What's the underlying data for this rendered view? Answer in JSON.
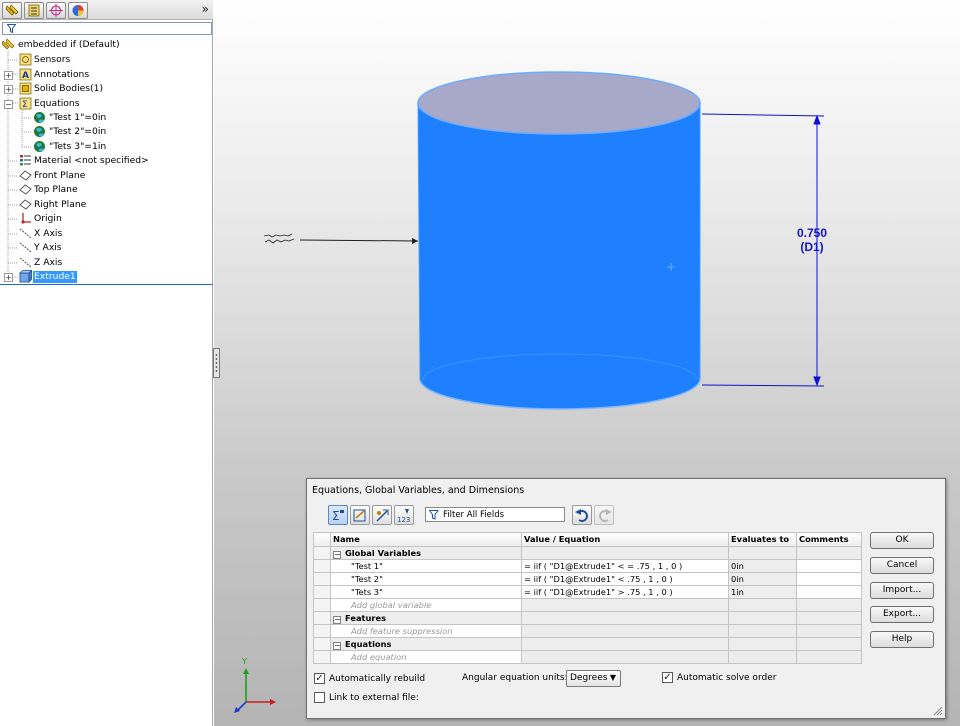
{
  "tree": {
    "root": "embedded if  (Default)",
    "items": [
      {
        "label": "Sensors",
        "icon": "sensors-icon",
        "expandable": false
      },
      {
        "label": "Annotations",
        "icon": "annotations-icon",
        "expandable": true
      },
      {
        "label": "Solid Bodies(1)",
        "icon": "solid-bodies-icon",
        "expandable": true
      },
      {
        "label": "Equations",
        "icon": "equations-icon",
        "expandable": true,
        "expanded": true
      },
      {
        "label": "\"Test 1\"=0in",
        "icon": "globe-icon"
      },
      {
        "label": "\"Test 2\"=0in",
        "icon": "globe-icon"
      },
      {
        "label": "\"Tets 3\"=1in",
        "icon": "globe-icon"
      },
      {
        "label": "Material <not specified>",
        "icon": "material-icon"
      },
      {
        "label": "Front Plane",
        "icon": "plane-icon"
      },
      {
        "label": "Top Plane",
        "icon": "plane-icon"
      },
      {
        "label": "Right Plane",
        "icon": "plane-icon"
      },
      {
        "label": "Origin",
        "icon": "origin-icon"
      },
      {
        "label": "X Axis",
        "icon": "axis-icon"
      },
      {
        "label": "Y Axis",
        "icon": "axis-icon"
      },
      {
        "label": "Z Axis",
        "icon": "axis-icon"
      },
      {
        "label": "Extrude1",
        "icon": "extrude-icon",
        "expandable": true,
        "selected": true
      }
    ]
  },
  "graphics": {
    "dimension_value": "0.750",
    "dimension_name": "(D1)",
    "body_color": "#1e7fff"
  },
  "dialog": {
    "title": "Equations, Global Variables, and Dimensions",
    "filter_placeholder": "Filter All Fields",
    "columns": [
      "Name",
      "Value / Equation",
      "Evaluates to",
      "Comments"
    ],
    "sections": {
      "globals": "Global Variables",
      "features": "Features",
      "equations": "Equations"
    },
    "rows": [
      {
        "name": "\"Test 1\"",
        "equation": "= iif ( \"D1@Extrude1\" < = .75 , 1 , 0 )",
        "evaluates": "0in",
        "comment": ""
      },
      {
        "name": "\"Test 2\"",
        "equation": "= iif ( \"D1@Extrude1\" < .75 , 1 , 0 )",
        "evaluates": "0in",
        "comment": ""
      },
      {
        "name": "\"Tets 3\"",
        "equation": "= iif ( \"D1@Extrude1\" > .75 , 1 , 0 )",
        "evaluates": "1in",
        "comment": ""
      }
    ],
    "add_global": "Add global variable",
    "add_feature": "Add feature suppression",
    "add_equation": "Add equation",
    "buttons": {
      "ok": "OK",
      "cancel": "Cancel",
      "import": "Import...",
      "export": "Export...",
      "help": "Help"
    },
    "auto_rebuild": "Automatically rebuild",
    "link_external": "Link to external file:",
    "angular_label": "Angular equation units:",
    "angular_value": "Degrees",
    "auto_solve": "Automatic solve order"
  }
}
